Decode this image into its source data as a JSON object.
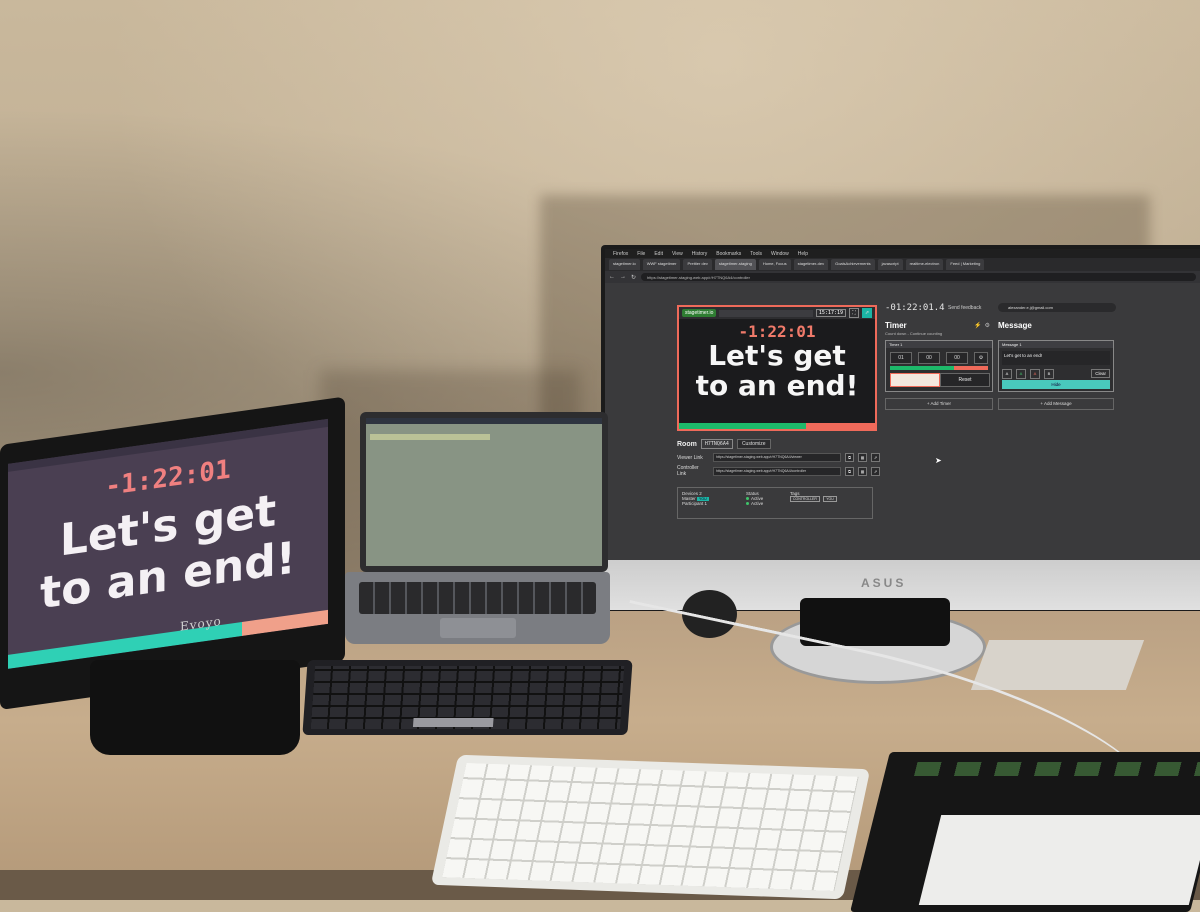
{
  "scene": {
    "description_free": true
  },
  "left_monitor": {
    "timer": "-1:22:01",
    "message_line1": "Let's get",
    "message_line2": "to an end!",
    "brand": "Evoyo",
    "progress_colors": [
      "#2fd0b5",
      "#f0a08a"
    ],
    "progress_split": 0.73
  },
  "main_monitor": {
    "brand": "ASUS",
    "menubar": [
      "Firefox",
      "File",
      "Edit",
      "View",
      "History",
      "Bookmarks",
      "Tools",
      "Window",
      "Help"
    ],
    "tabs": [
      "stagetimer.io",
      "WWF stagetimer",
      "Prettier dev",
      "stagetimer-staging",
      "Home, Focus",
      "stagetimer-dev",
      "GoalsAchievements",
      "javascript",
      "realtime-electron",
      "Feed | Marketing"
    ],
    "url": "https://stagetimer-staging.web.app/r/H7TNQ6A4/controller",
    "preview": {
      "logo": "stagetimer.io",
      "clock": "15:17:19",
      "timer": "-1:22:01",
      "message_line1": "Let's get",
      "message_line2": "to an end!",
      "progress_colors": [
        "#1db96a",
        "#ef6a5a"
      ],
      "progress_split": 0.65
    },
    "room": {
      "label": "Room",
      "id": "H7TNQ6A4",
      "customize": "Customize"
    },
    "links": [
      {
        "label": "Viewer Link",
        "url": "https://stagetimer-staging.web.app/r/H7TNQ6A4/viewer"
      },
      {
        "label": "Controller Link",
        "url": "https://stagetimer-staging.web.app/r/H7TNQ6A4/controller"
      }
    ],
    "devices": {
      "header": "Devices 2",
      "status_header": "Status",
      "tags_header": "Tags",
      "rows": [
        {
          "name": "Master",
          "badge": "YOU",
          "status": "Active",
          "tags": [
            "CONTROLLER",
            "YOU"
          ]
        },
        {
          "name": "Participant 1",
          "status": "Active"
        }
      ]
    },
    "top_clock": "-01:22:01.4",
    "send_feedback": "Send feedback",
    "account": "alexander.e.j@gmail.com",
    "timer_panel": {
      "title": "Timer",
      "subtitle": "Count down - Continue counting",
      "box_title": "Timer 1",
      "hours": "01",
      "minutes": "00",
      "seconds": "00",
      "reset": "Reset",
      "add": "+ Add Timer",
      "progress_colors": [
        "#1db96a",
        "#ef6a5a"
      ],
      "progress_split": 0.65
    },
    "message_panel": {
      "title": "Message",
      "box_title": "Message 1",
      "text": "Let's get to an end!",
      "clear": "Clear",
      "hide": "Hide",
      "add": "+ Add Message"
    }
  }
}
